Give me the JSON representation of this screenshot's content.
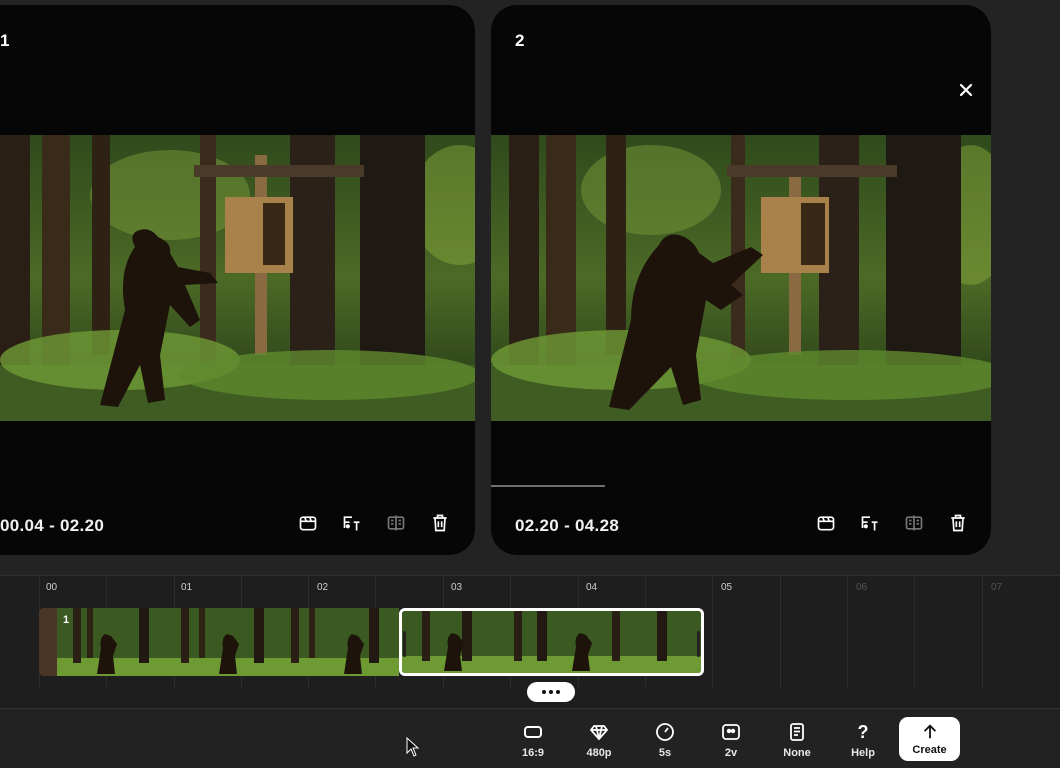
{
  "clips": [
    {
      "number": "1",
      "time_range": "00.04 - 02.20"
    },
    {
      "number": "2",
      "time_range": "02.20 - 04.28"
    }
  ],
  "card_actions": [
    "clapperboard-icon",
    "text-to-speech-icon",
    "compare-icon",
    "trash-icon"
  ],
  "timeline": {
    "ruler": [
      "00",
      "01",
      "02",
      "03",
      "04",
      "05",
      "06",
      "07"
    ],
    "film_label": "1"
  },
  "toolbar": {
    "items": [
      {
        "label": "16:9",
        "icon": "aspect-ratio-icon"
      },
      {
        "label": "480p",
        "icon": "diamond-icon"
      },
      {
        "label": "5s",
        "icon": "timer-icon"
      },
      {
        "label": "2v",
        "icon": "variations-icon"
      },
      {
        "label": "None",
        "icon": "document-icon"
      },
      {
        "label": "Help",
        "icon": "question-icon"
      }
    ],
    "create_label": "Create"
  },
  "colors": {
    "background": "#232323",
    "card": "#060606",
    "accent": "#ffffff",
    "forest": "#3b4a26"
  }
}
